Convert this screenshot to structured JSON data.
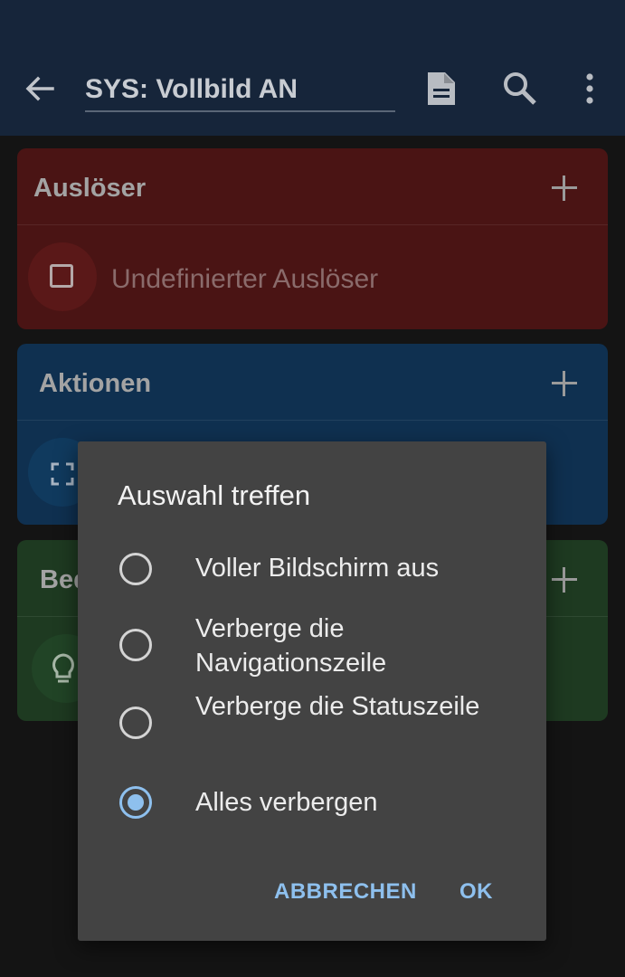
{
  "appbar": {
    "title": "SYS: Vollbild AN",
    "icons": [
      "back-arrow-icon",
      "document-icon",
      "search-icon",
      "more-vert-icon"
    ]
  },
  "cards": {
    "trigger": {
      "title": "Auslöser",
      "item_label": "Undefinierter Auslöser",
      "item_icon": "checkbox-icon",
      "color": "#4a1414"
    },
    "actions": {
      "title": "Aktionen",
      "item_icon": "fullscreen-icon",
      "color": "#0f3050"
    },
    "conditions": {
      "title": "Bed",
      "item_icon": "lightbulb-icon",
      "color": "#1e3a21"
    }
  },
  "dialog": {
    "title": "Auswahl treffen",
    "options": [
      {
        "label": "Voller Bildschirm aus",
        "selected": false
      },
      {
        "label": "Verberge die Navigationszeile",
        "selected": false
      },
      {
        "label": "Verberge die Statuszeile",
        "selected": false
      },
      {
        "label": "Alles verbergen",
        "selected": true
      }
    ],
    "cancel_label": "ABBRECHEN",
    "ok_label": "OK",
    "accent_color": "#8ec0ee"
  }
}
